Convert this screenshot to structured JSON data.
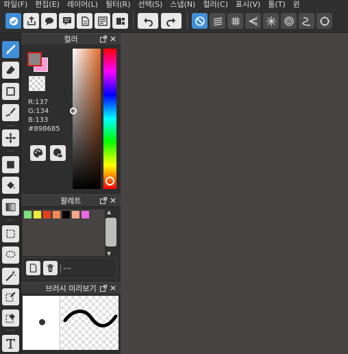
{
  "menu": [
    {
      "label": "파일(F)"
    },
    {
      "label": "편집(E)"
    },
    {
      "label": "레이어(L)"
    },
    {
      "label": "필터(R)"
    },
    {
      "label": "선택(S)"
    },
    {
      "label": "스냅(N)"
    },
    {
      "label": "컬러(C)"
    },
    {
      "label": "표시(V)"
    },
    {
      "label": "툴(T)"
    },
    {
      "label": "윈"
    }
  ],
  "panels": {
    "color": {
      "title": "컬러",
      "r": "R:137",
      "g": "G:134",
      "b": "B:133",
      "hex": "#898685",
      "foreground": "#898685",
      "background": "#ff9ad8"
    },
    "palette": {
      "title": "팔레트",
      "chips": [
        "#7fe07f",
        "#ecec3c",
        "#e83d1d",
        "#f08a55",
        "#000000",
        "#f3a88a",
        "#e86ae0"
      ],
      "name": "---"
    },
    "brush": {
      "title": "브러시 미리보기"
    }
  },
  "colors": {
    "accent": "#3f8fd8",
    "panel_header": "#3a3a3a",
    "canvas_bg": "#474342"
  }
}
